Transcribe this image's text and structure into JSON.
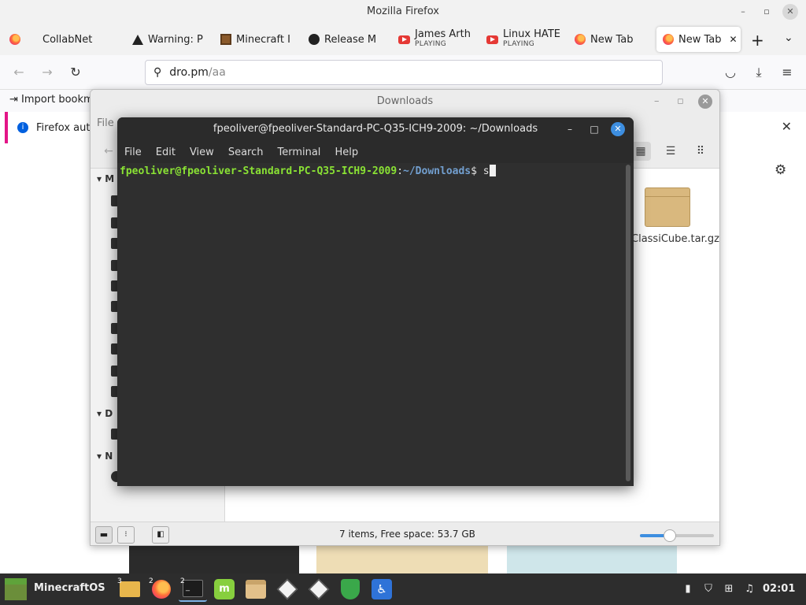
{
  "firefox": {
    "window_title": "Mozilla Firefox",
    "tabs": [
      {
        "label": "CollabNet",
        "sub": "",
        "icon": "firefox-icon"
      },
      {
        "label": "Warning: P",
        "sub": "",
        "icon": "warning-icon"
      },
      {
        "label": "Minecraft I",
        "sub": "",
        "icon": "minecraft-icon"
      },
      {
        "label": "Release M",
        "sub": "",
        "icon": "github-icon"
      },
      {
        "label": "James Arth",
        "sub": "PLAYING",
        "icon": "youtube-icon"
      },
      {
        "label": "Linux HATE",
        "sub": "PLAYING",
        "icon": "youtube-icon"
      },
      {
        "label": "New Tab",
        "sub": "",
        "icon": "firefox-icon"
      },
      {
        "label": "New Tab",
        "sub": "",
        "icon": "firefox-icon",
        "active": true
      }
    ],
    "url_host": "dro.pm",
    "url_path": "/aa",
    "bookmark_import": "Import bookm",
    "notice_text": "Firefox auto"
  },
  "nemo": {
    "title": "Downloads",
    "menu_file": "File",
    "sidebar_section_initials": [
      "M",
      "D",
      "N"
    ],
    "file_name": "ClassiCube.tar.gz",
    "status_text": "7 items, Free space: 53.7 GB",
    "zoom_level": 0.4
  },
  "terminal": {
    "title": "fpeoliver@fpeoliver-Standard-PC-Q35-ICH9-2009: ~/Downloads",
    "menu": [
      "File",
      "Edit",
      "View",
      "Search",
      "Terminal",
      "Help"
    ],
    "prompt_user": "fpeoliver@fpeoliver-Standard-PC-Q35-ICH9-2009",
    "prompt_sep": ":",
    "prompt_path": "~/Downloads",
    "prompt_symbol": "$",
    "typed": "s"
  },
  "taskbar": {
    "menu_label": "MinecraftOS",
    "apps": [
      {
        "name": "files-app-icon",
        "badge": "3"
      },
      {
        "name": "firefox-app-icon",
        "badge": "2"
      },
      {
        "name": "terminal-app-icon",
        "badge": "2",
        "active": true
      },
      {
        "name": "mint-update-icon",
        "badge": ""
      },
      {
        "name": "archive-app-icon",
        "badge": ""
      },
      {
        "name": "cube-app-icon",
        "badge": ""
      },
      {
        "name": "cube-app-icon-2",
        "badge": ""
      },
      {
        "name": "shield-app-icon",
        "badge": ""
      },
      {
        "name": "accessibility-app-icon",
        "badge": ""
      }
    ],
    "clock": "02:01"
  },
  "colors": {
    "accent": "#e31587",
    "prompt_user": "#8ae234",
    "prompt_path": "#729fcf",
    "close_button": "#3d8ee0"
  }
}
